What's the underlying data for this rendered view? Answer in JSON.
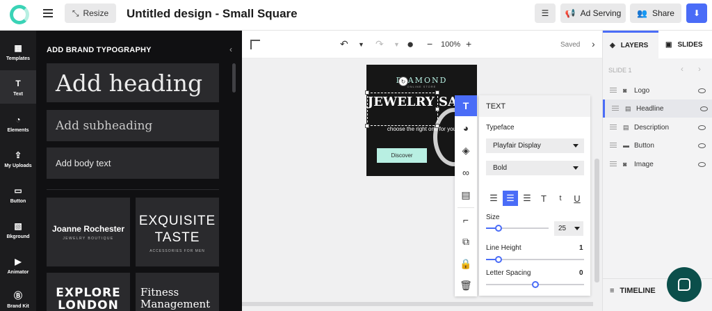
{
  "topbar": {
    "resize_label": "Resize",
    "title": "Untitled design - Small Square",
    "ad_serving_label": "Ad Serving",
    "share_label": "Share"
  },
  "rail": {
    "items": [
      {
        "label": "Templates",
        "icon": "templates-icon"
      },
      {
        "label": "Text",
        "icon": "text-icon"
      },
      {
        "label": "Elements",
        "icon": "elements-icon"
      },
      {
        "label": "My Uploads",
        "icon": "uploads-icon"
      },
      {
        "label": "Button",
        "icon": "button-icon"
      },
      {
        "label": "Bkground",
        "icon": "background-icon"
      },
      {
        "label": "Animator",
        "icon": "animator-icon"
      },
      {
        "label": "Brand Kit",
        "icon": "brand-kit-icon"
      }
    ]
  },
  "panel": {
    "title": "ADD BRAND TYPOGRAPHY",
    "heading": "Add heading",
    "subheading": "Add subheading",
    "body": "Add body text",
    "cards": [
      {
        "main": "Joanne Rochester",
        "sub": "JEWELRY BOUTIQUE"
      },
      {
        "main": "EXQUISITE TASTE",
        "sub": "ACCESSORIES FOR MEN"
      },
      {
        "main": "EXPLORE LONDON",
        "sub": ""
      },
      {
        "main": "Fitness Management",
        "sub": ""
      }
    ]
  },
  "canvas": {
    "zoom": "100%",
    "saved": "Saved"
  },
  "design": {
    "logo": "DIAMOND",
    "logo_sub": "ONLINE STORE",
    "headline": "JEWELRY SALE",
    "description": "choose the right one for you",
    "button": "Discover"
  },
  "text_panel": {
    "title": "TEXT",
    "typeface_label": "Typeface",
    "typeface": "Playfair Display",
    "weight": "Bold",
    "size_label": "Size",
    "size": "25",
    "size_fraction": 0.2,
    "line_height_label": "Line Height",
    "line_height": "1",
    "line_height_fraction": 0.13,
    "letter_spacing_label": "Letter Spacing",
    "letter_spacing": "0",
    "letter_spacing_fraction": 0.5,
    "align_options": [
      "align-left",
      "align-center",
      "align-right",
      "uppercase",
      "lowercase",
      "underline"
    ],
    "active_align": "align-center"
  },
  "layers": {
    "tab_layers": "LAYERS",
    "tab_slides": "SLIDES",
    "slide_label": "SLIDE 1",
    "items": [
      {
        "name": "Logo",
        "icon": "camera-icon"
      },
      {
        "name": "Headline",
        "icon": "text-layer-icon"
      },
      {
        "name": "Description",
        "icon": "text-layer-icon"
      },
      {
        "name": "Button",
        "icon": "button-layer-icon"
      },
      {
        "name": "Image",
        "icon": "camera-icon"
      }
    ],
    "active": "Headline",
    "timeline": "TIMELINE"
  },
  "colors": {
    "accent": "#4a6cf7",
    "brand_mint": "#b8efe2",
    "panel_dark": "#101012"
  }
}
